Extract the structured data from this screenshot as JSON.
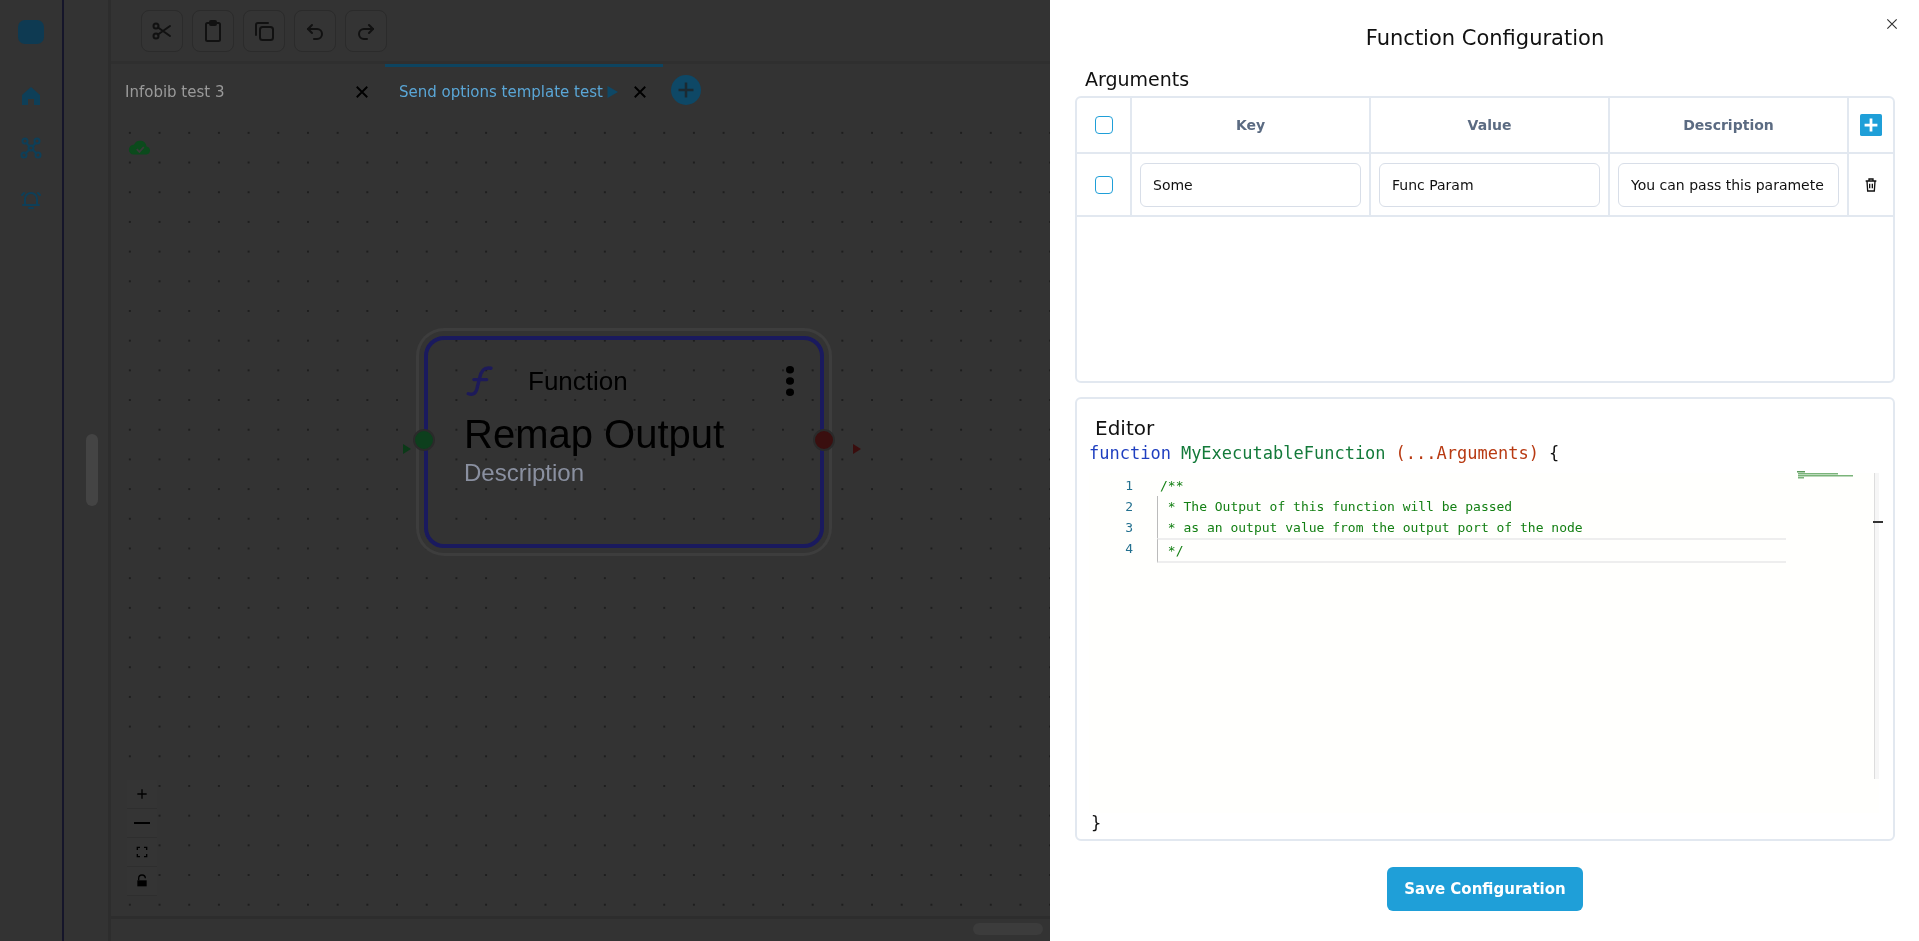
{
  "app_sidebar": {
    "items": [
      {
        "kind": "home"
      },
      {
        "kind": "graph"
      },
      {
        "kind": "alarm"
      }
    ]
  },
  "canvas_toolbar": {
    "tools": [
      {
        "kind": "cut"
      },
      {
        "kind": "paste"
      },
      {
        "kind": "copy"
      },
      {
        "kind": "undo"
      },
      {
        "kind": "redo"
      }
    ]
  },
  "tabs": [
    {
      "label": "Infobib test 3",
      "selected": false,
      "runnable": false
    },
    {
      "label": "Send options template test",
      "selected": true,
      "runnable": true
    }
  ],
  "canvas": {
    "saved": true,
    "node": {
      "type_label": "Function",
      "title": "Remap Output",
      "description": "Description"
    },
    "zoom_controls": [
      {
        "kind": "zoom_in"
      },
      {
        "kind": "zoom_out"
      },
      {
        "kind": "fit"
      },
      {
        "kind": "lock"
      }
    ]
  },
  "drawer": {
    "title": "Function Configuration",
    "arguments": {
      "heading": "Arguments",
      "all_checked": false,
      "columns": [
        "Key",
        "Value",
        "Description"
      ],
      "rows": [
        {
          "checked": false,
          "key": "Some",
          "value": "Func Param",
          "description": "You can pass this paramete"
        }
      ]
    },
    "editor": {
      "heading": "Editor",
      "signature": [
        {
          "kind": "keyword",
          "text": "function"
        },
        {
          "kind": "name",
          "text": "MyExecutableFunction"
        },
        {
          "kind": "params",
          "text": "(...Arguments)"
        },
        {
          "kind": "brace",
          "text": "{"
        }
      ],
      "lines": [
        {
          "number": "1",
          "text": "/**",
          "current": false
        },
        {
          "number": "2",
          "text": " * The Output of this function will be passed",
          "current": false
        },
        {
          "number": "3",
          "text": " * as an output value from the output port of the node",
          "current": false
        },
        {
          "number": "4",
          "text": " */",
          "current": true
        }
      ],
      "closing": "}"
    },
    "save_button": "Save Configuration"
  }
}
